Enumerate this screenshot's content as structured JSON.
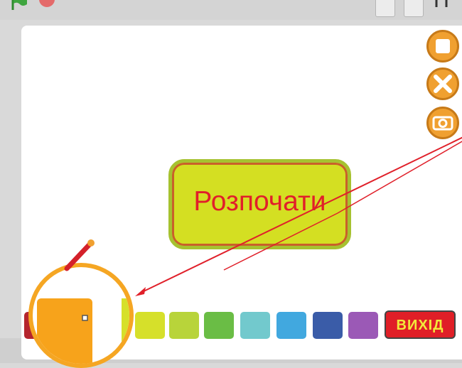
{
  "app": {
    "start_button_label": "Розпочати",
    "exit_button_label": "ВИХІД"
  },
  "toolbar": {
    "icons": [
      "green-flag-icon",
      "stop-icon",
      "small-stage-icon",
      "normal-stage-icon",
      "fullscreen-icon"
    ]
  },
  "side_buttons": [
    "square-stop-icon",
    "close-x-icon",
    "camera-icon"
  ],
  "palette": {
    "colors": [
      "#b5252d",
      "#f7a31b",
      "#ffffff",
      "#d6e02a",
      "#b8d43a",
      "#8dc63f",
      "#6abd45",
      "#72c9cd",
      "#41a8df",
      "#3a5ca8",
      "#9b59b6"
    ]
  },
  "colors": {
    "start_fill": "#d4df22",
    "start_text": "#e11f2a",
    "exit_fill": "#e01f27",
    "exit_text": "#f2ea3a",
    "annotation_arrow": "#e0202a",
    "magnifier_ring": "#f5a623"
  }
}
